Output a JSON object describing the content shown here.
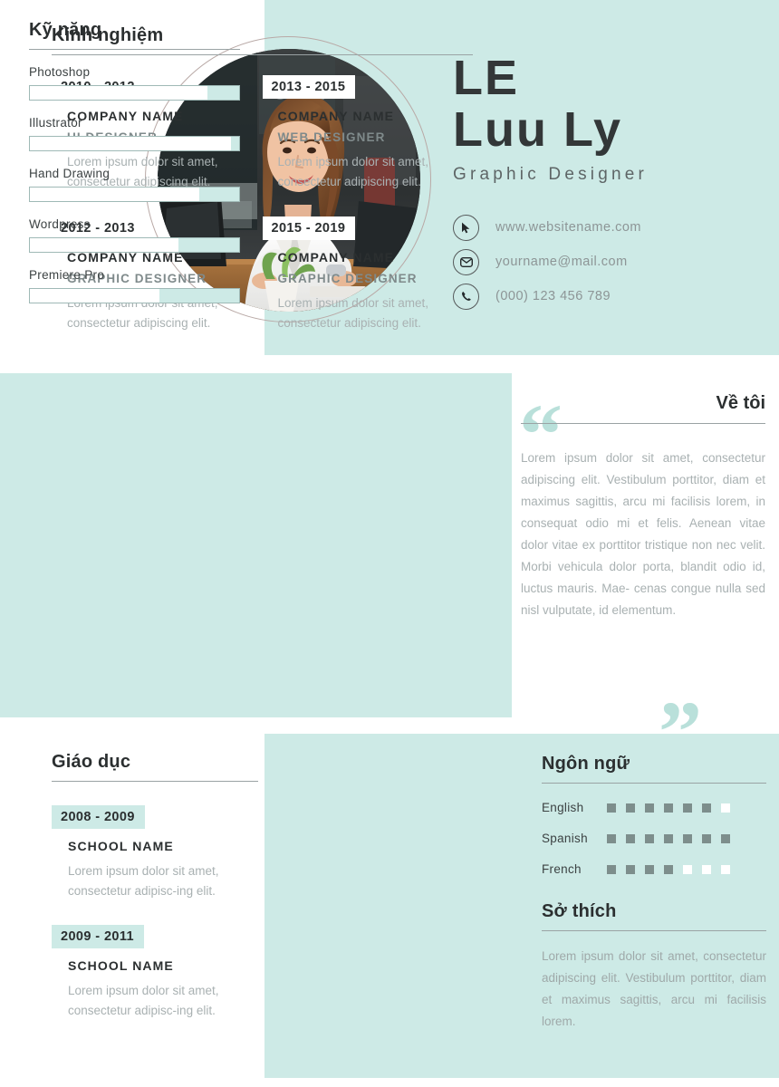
{
  "profile": {
    "first_name": "LE",
    "last_name": "Luu Ly",
    "job_title": "Graphic Designer",
    "photo_alt": "profile-photo"
  },
  "contacts": [
    {
      "icon": "cursor-icon",
      "value": "www.websitename.com"
    },
    {
      "icon": "envelope-icon",
      "value": "yourname@mail.com"
    },
    {
      "icon": "phone-icon",
      "value": "(000) 123 456 789"
    }
  ],
  "experience": {
    "heading": "Kinh nghiệm",
    "items": [
      {
        "dates": "2010 - 2012",
        "company": "COMPANY NAME",
        "role": "UI DESIGNER",
        "description": "Lorem ipsum dolor sit amet, consectetur adipiscing elit."
      },
      {
        "dates": "2013 - 2015",
        "company": "COMPANY NAME",
        "role": "WEB DESIGNER",
        "description": "Lorem ipsum dolor sit amet, consectetur adipiscing elit."
      },
      {
        "dates": "2012 - 2013",
        "company": "COMPANY NAME",
        "role": "GRAPHIC DESIGNER",
        "description": "Lorem ipsum dolor sit amet, consectetur adipiscing elit."
      },
      {
        "dates": "2015 - 2019",
        "company": "COMPANY NAME",
        "role": "GRAPHIC DESIGNER",
        "description": "Lorem ipsum dolor sit amet, consectetur adipiscing elit."
      }
    ]
  },
  "about": {
    "heading": "Về tôi",
    "quote_open": "“",
    "quote_close": "”",
    "text": "Lorem ipsum dolor sit amet, consectetur adipiscing elit. Vestibulum porttitor, diam et maximus sagittis, arcu mi facilisis lorem, in consequat odio mi et felis. Aenean vitae dolor vitae ex porttitor tristique non nec velit. Morbi vehicula dolor porta, blandit odio id, luctus mauris. Mae- cenas congue nulla sed nisl vulputate, id elementum."
  },
  "education": {
    "heading": "Giáo dục",
    "items": [
      {
        "dates": "2008 - 2009",
        "school": "SCHOOL NAME",
        "description": "Lorem ipsum dolor sit amet, consectetur adipisc-ing elit."
      },
      {
        "dates": "2009 - 2011",
        "school": "SCHOOL NAME",
        "description": "Lorem ipsum dolor sit amet, consectetur adipisc-ing elit."
      }
    ]
  },
  "skills": {
    "heading": "Kỹ năng",
    "items": [
      {
        "label": "Photoshop",
        "percent": 85
      },
      {
        "label": "Illustrator",
        "percent": 96
      },
      {
        "label": "Hand Drawing",
        "percent": 81
      },
      {
        "label": "Wordpress",
        "percent": 71
      },
      {
        "label": "Premiere Pro",
        "percent": 62
      }
    ]
  },
  "languages": {
    "heading": "Ngôn ngữ",
    "total_dots": 7,
    "items": [
      {
        "name": "English",
        "level": 6
      },
      {
        "name": "Spanish",
        "level": 7
      },
      {
        "name": "French",
        "level": 4
      }
    ]
  },
  "interests": {
    "heading": "Sở thích",
    "text": "Lorem ipsum dolor sit amet, consectetur adipiscing elit. Vestibulum porttitor, diam et maximus sagittis, arcu mi facilisis lorem."
  },
  "colors": {
    "mint": "#cdeae6",
    "mint_light": "#b9e0da",
    "dark": "#2b2f30",
    "muted": "#a9b1b2",
    "dot_on": "#7d8e8c"
  }
}
